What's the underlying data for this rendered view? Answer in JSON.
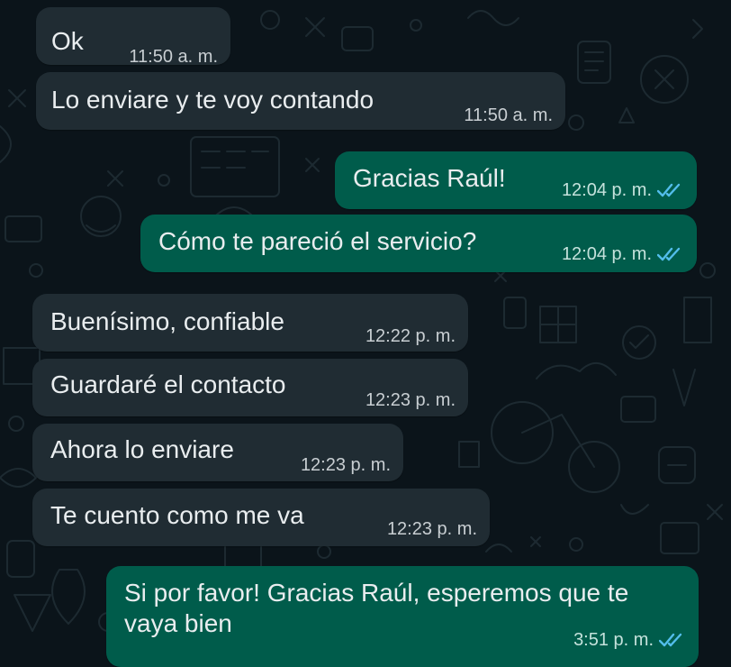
{
  "conversation": {
    "messages": [
      {
        "direction": "incoming",
        "text": "Ok",
        "time": "11:50 a. m."
      },
      {
        "direction": "incoming",
        "text": "Lo enviare y te voy contando",
        "time": "11:50 a. m."
      },
      {
        "direction": "outgoing",
        "text": "Gracias Raúl!",
        "time": "12:04 p. m.",
        "status": "read"
      },
      {
        "direction": "outgoing",
        "text": "Cómo te pareció el servicio?",
        "time": "12:04 p. m.",
        "status": "read"
      },
      {
        "direction": "incoming",
        "text": "Buenísimo, confiable",
        "time": "12:22 p. m."
      },
      {
        "direction": "incoming",
        "text": "Guardaré el contacto",
        "time": "12:23 p. m."
      },
      {
        "direction": "incoming",
        "text": "Ahora lo enviare",
        "time": "12:23 p. m."
      },
      {
        "direction": "incoming",
        "text": "Te cuento como me va",
        "time": "12:23 p. m."
      },
      {
        "direction": "outgoing",
        "text": "Si por favor! Gracias Raúl, esperemos que te vaya bien",
        "time": "3:51 p. m.",
        "status": "read"
      }
    ]
  },
  "colors": {
    "background": "#0b141a",
    "incoming_bubble": "#202c33",
    "outgoing_bubble": "#005c4b",
    "read_ticks": "#53bdeb"
  },
  "icons": {
    "read_receipt": "double-check-icon"
  }
}
